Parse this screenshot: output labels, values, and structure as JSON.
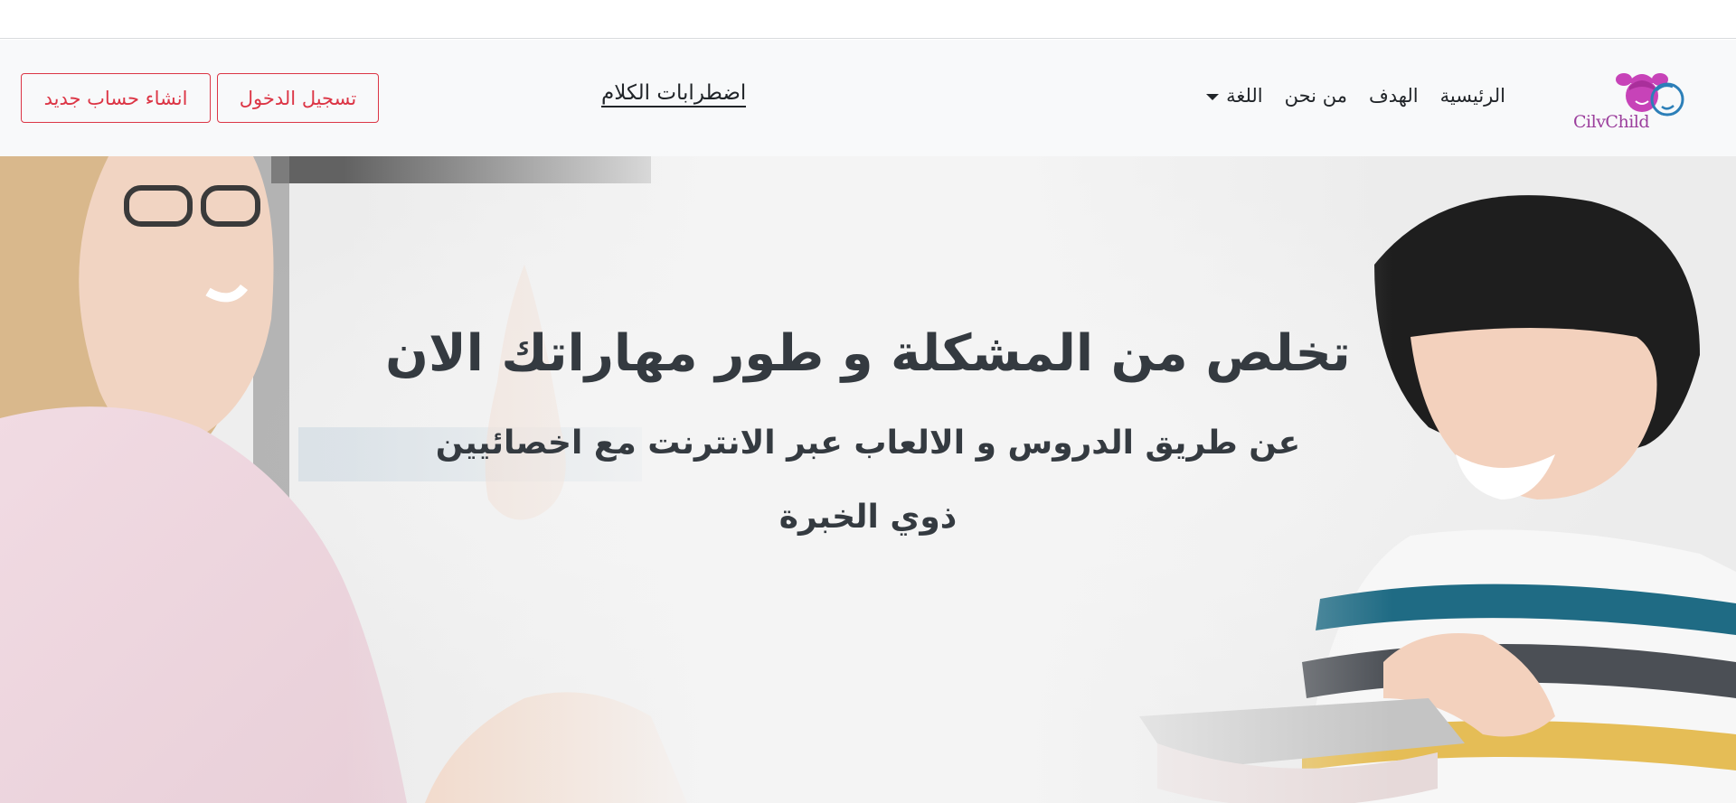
{
  "navbar": {
    "logo_text": "CilvChild",
    "links": [
      "الرئيسية",
      "الهدف",
      "من نحن"
    ],
    "language_label": "اللغة",
    "brand_link": "اضطرابات الكلام",
    "login_label": "تسجيل الدخول",
    "register_label": "انشاء حساب جديد"
  },
  "hero": {
    "title": "تخلص من المشكلة و طور مهاراتك الان",
    "subtitle": "عن طريق الدروس و الالعاب عبر الانترنت مع اخصائيين ذوي الخبرة"
  },
  "colors": {
    "accent_outline": "#dc3545",
    "navbar_bg": "#f8f9fa",
    "logo_pink": "#c743b8",
    "logo_blue": "#2c7fb8"
  },
  "icons": [
    "logo-girl-icon",
    "logo-boy-icon",
    "caret-down-icon"
  ]
}
